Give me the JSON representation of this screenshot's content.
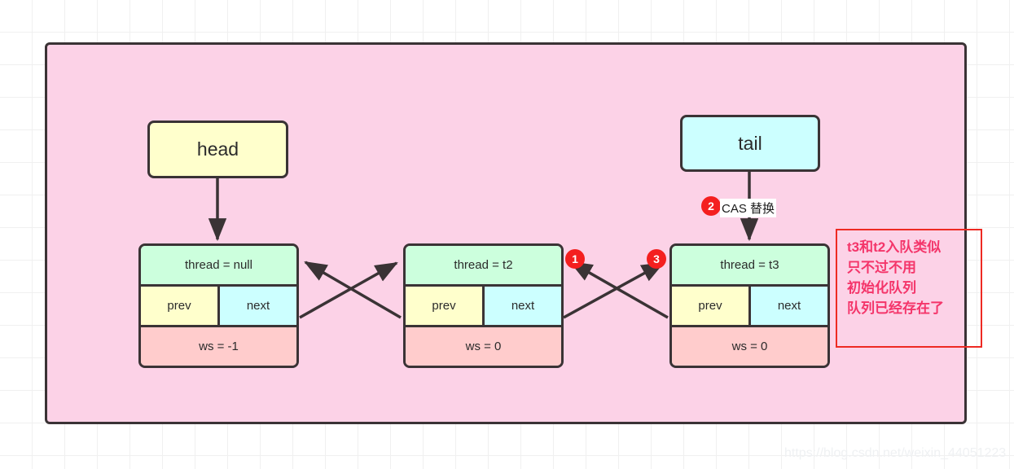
{
  "diagram": {
    "title": "AQS CLH queue node linkage",
    "pointers": {
      "head": "head",
      "tail": "tail"
    },
    "nodes": [
      {
        "thread": "thread = null",
        "prev": "prev",
        "next": "next",
        "ws": "ws = -1"
      },
      {
        "thread": "thread = t2",
        "prev": "prev",
        "next": "next",
        "ws": "ws = 0"
      },
      {
        "thread": "thread = t3",
        "prev": "prev",
        "next": "next",
        "ws": "ws = 0"
      }
    ],
    "badges": {
      "one": "1",
      "two": "2",
      "three": "3"
    },
    "cas_label": "CAS 替换",
    "note": {
      "lines": [
        "t3和t2入队类似",
        "只不过不用",
        "初始化队列",
        "队列已经存在了"
      ]
    },
    "watermark": "https://blog.csdn.net/weixin_44051223",
    "colors": {
      "panel_fill": "#fcd2e7",
      "panel_stroke": "#3a3335",
      "head_fill": "#ffffcc",
      "tail_fill": "#ccffff",
      "thread_fill": "#ccffdd",
      "prev_fill": "#ffffcc",
      "next_fill": "#ccffff",
      "ws_fill": "#ffcccc",
      "badge_fill": "#f41f1f",
      "note_stroke": "#ee2a23",
      "note_text": "#f4356a"
    }
  }
}
